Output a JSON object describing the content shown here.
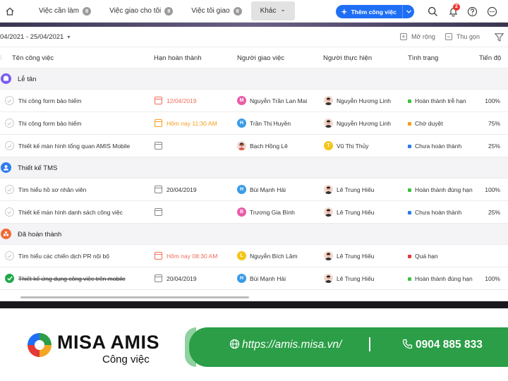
{
  "nav": {
    "tabs": [
      {
        "label": "Việc cần làm",
        "count": "8"
      },
      {
        "label": "Việc giao cho tôi",
        "count": "8"
      },
      {
        "label": "Việc tôi giao",
        "count": "8"
      },
      {
        "label": "Khác",
        "caret": "⌄"
      }
    ],
    "add_button": "Thêm công việc",
    "notification_count": "2"
  },
  "toolbar": {
    "date_range": "04/2021 - 25/04/2021",
    "expand_label": "Mở rộng",
    "collapse_label": "Thu gọn"
  },
  "columns": [
    "Tên công việc",
    "Hạn hoàn thành",
    "Người giao việc",
    "Người thực hiện",
    "Tình trạng",
    "Tiến độ"
  ],
  "groups": [
    {
      "title": "Lễ tân",
      "color": "#7b5cf2",
      "tasks": [
        {
          "name": "Thi công form bảo hiểm",
          "deadline": "12/04/2019",
          "deadline_style": "overdue",
          "assigner": "Nguyễn Trần Lan Mai",
          "assigner_initial": "M",
          "assigner_color": "#e95ca8",
          "assignee": "Nguyễn Hương Linh",
          "status": "Hoàn thành trễ hạn",
          "status_color": "#3cc23c",
          "progress": "100%"
        },
        {
          "name": "Thi công form bảo hiểm",
          "deadline": "Hôm nay 11:30 AM",
          "deadline_style": "today",
          "assigner": "Trần Thị Huyền",
          "assigner_initial": "H",
          "assigner_color": "#3b9be6",
          "assignee": "Nguyễn Hương Linh",
          "status": "Chờ duyệt",
          "status_color": "#f59b1a",
          "progress": "75%"
        },
        {
          "name": "Thiết kế màn hình tổng quan AMIS Mobile",
          "deadline": "",
          "deadline_style": "none",
          "assigner": "Bạch Hồng Lê",
          "assigner_initial": "",
          "assigner_color": "",
          "assignee": "Vũ Thị Thủy",
          "assignee_initial": "T",
          "assignee_color": "#f5c518",
          "status": "Chưa hoàn thành",
          "status_color": "#2f7bf0",
          "progress": "25%"
        }
      ]
    },
    {
      "title": "Thiết kế TMS",
      "color": "#2f7bf0",
      "tasks": [
        {
          "name": "Tìm hiểu hồ sơ nhân viên",
          "deadline": "20/04/2019",
          "deadline_style": "normal",
          "assigner": "Bùi Mạnh Hải",
          "assigner_initial": "H",
          "assigner_color": "#3b9be6",
          "assignee": "Lê Trung Hiếu",
          "status": "Hoàn thành đúng hạn",
          "status_color": "#3cc23c",
          "progress": "100%"
        },
        {
          "name": "Thiết kế màn hình danh sách công việc",
          "deadline": "",
          "deadline_style": "none",
          "assigner": "Trương Gia Bình",
          "assigner_initial": "B",
          "assigner_color": "#e95ca8",
          "assignee": "Lê Trung Hiếu",
          "status": "Chưa hoàn thành",
          "status_color": "#2f7bf0",
          "progress": "25%"
        }
      ]
    },
    {
      "title": "Đã hoàn thành",
      "color": "#f26a36",
      "tasks": [
        {
          "name": "Tìm hiểu các chiến dịch PR nội bộ",
          "deadline": "Hôm nay 08:30 AM",
          "deadline_style": "overdue",
          "assigner": "Nguyễn Bích Lâm",
          "assigner_initial": "L",
          "assigner_color": "#f5c518",
          "assignee": "Lê Trung Hiếu",
          "status": "Quá hạn",
          "status_color": "#e33b3b",
          "progress": ""
        },
        {
          "name": "Thiết kế ứng dụng công việc trên mobile",
          "deadline": "20/04/2019",
          "deadline_style": "normal",
          "assigner": "Bùi Mạnh Hải",
          "assigner_initial": "H",
          "assigner_color": "#3b9be6",
          "assignee": "Lê Trung Hiếu",
          "status": "Hoàn thành đúng hạn",
          "status_color": "#3cc23c",
          "progress": "100%",
          "done": true
        }
      ]
    }
  ],
  "banner": {
    "brand": "MISA AMIS",
    "subtitle": "Công việc",
    "url": "https://amis.misa.vn/",
    "phone": "0904 885 833"
  }
}
